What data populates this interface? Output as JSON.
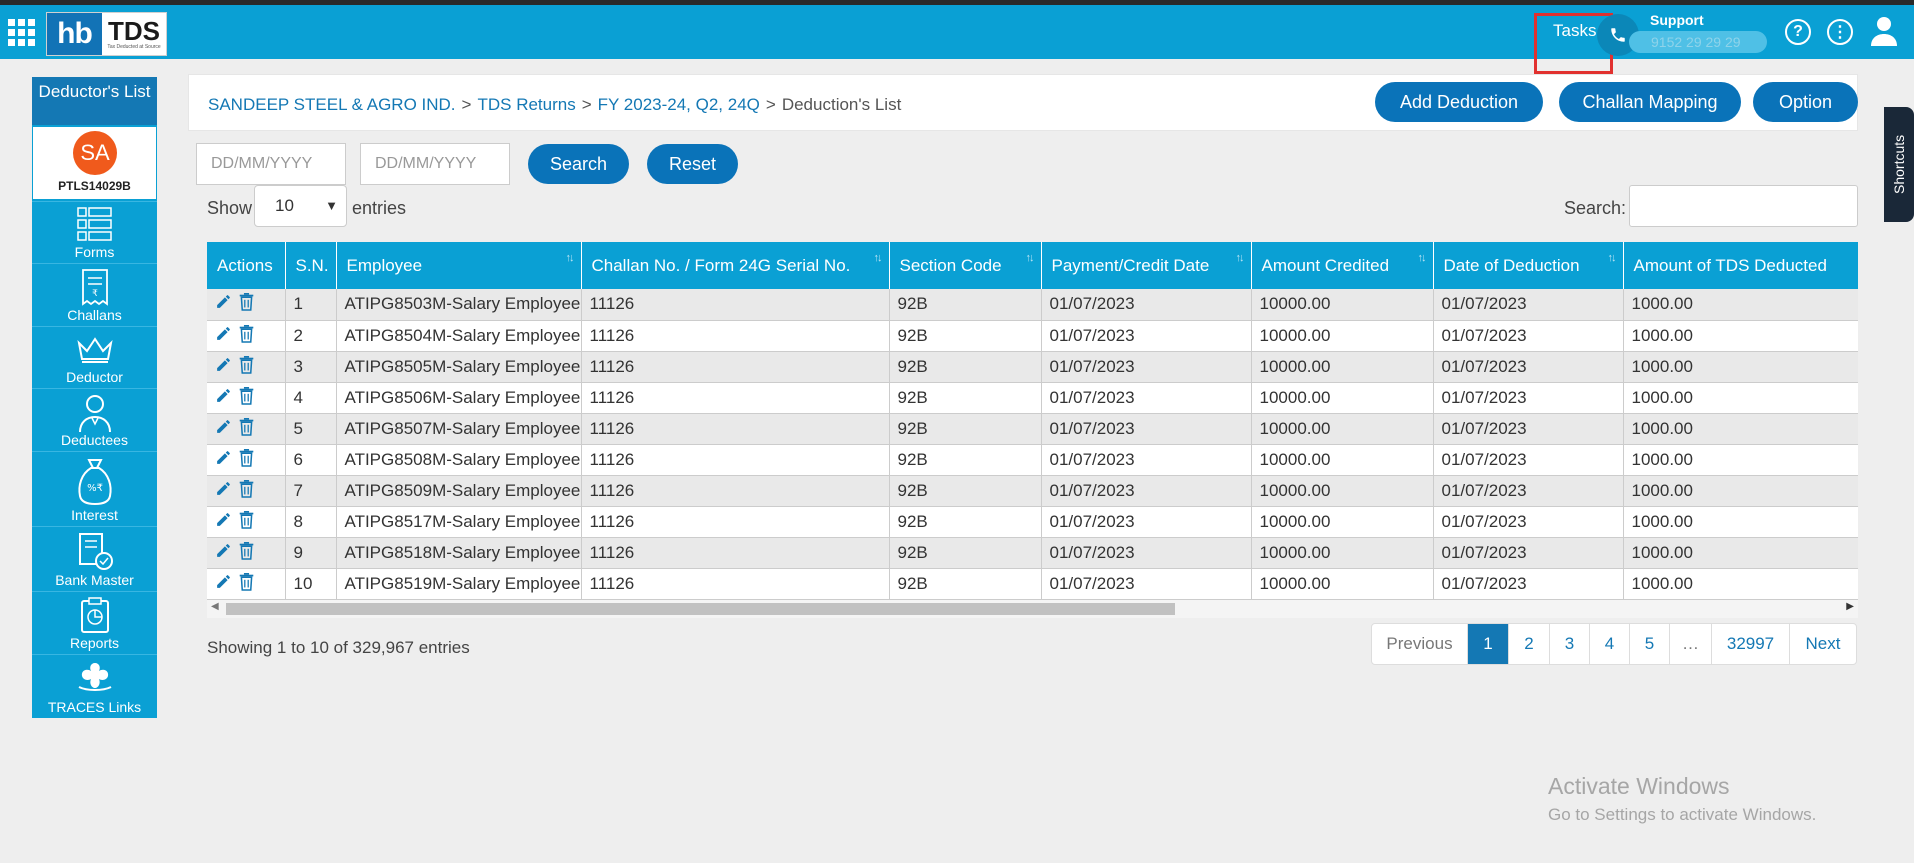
{
  "header": {
    "logo_hb": "hb",
    "logo_tds": "TDS",
    "logo_tagline": "Tax Deducted at Source",
    "tasks_label": "Tasks",
    "support_label": "Support",
    "support_number": "9152 29 29 29"
  },
  "sidebar": {
    "title": "Deductor's List",
    "user_initials": "SA",
    "user_pan": "PTLS14029B",
    "items": [
      {
        "label": "Forms",
        "icon": "forms-icon"
      },
      {
        "label": "Challans",
        "icon": "challans-icon"
      },
      {
        "label": "Deductor",
        "icon": "crown-icon"
      },
      {
        "label": "Deductees",
        "icon": "deductees-icon"
      },
      {
        "label": "Interest",
        "icon": "money-bag-icon"
      },
      {
        "label": "Bank Master",
        "icon": "bank-icon"
      },
      {
        "label": "Reports",
        "icon": "clipboard-icon"
      },
      {
        "label": "TRACES Links",
        "icon": "traces-icon"
      }
    ]
  },
  "shortcuts_label": "Shortcuts",
  "breadcrumb": {
    "company": "SANDEEP STEEL & AGRO IND.",
    "section": "TDS Returns",
    "period": "FY 2023-24, Q2, 24Q",
    "current": "Deduction's List"
  },
  "actions": {
    "add_deduction": "Add Deduction",
    "challan_mapping": "Challan Mapping",
    "option": "Option"
  },
  "filters": {
    "from_placeholder": "DD/MM/YYYY",
    "to_placeholder": "DD/MM/YYYY",
    "search_button": "Search",
    "reset_button": "Reset"
  },
  "table_controls": {
    "show_label": "Show",
    "page_size": "10",
    "entries_label": "entries",
    "search_label": "Search:"
  },
  "table": {
    "columns": [
      "Actions",
      "S.N.",
      "Employee",
      "Challan No. / Form 24G Serial No.",
      "Section Code",
      "Payment/Credit Date",
      "Amount Credited",
      "Date of Deduction",
      "Amount of TDS Deducted"
    ],
    "rows": [
      {
        "sn": "1",
        "employee": "ATIPG8503M-Salary Employee",
        "challan": "11126",
        "section": "92B",
        "payment_date": "01/07/2023",
        "amount": "10000.00",
        "deduction_date": "01/07/2023",
        "tds": "1000.00"
      },
      {
        "sn": "2",
        "employee": "ATIPG8504M-Salary Employee",
        "challan": "11126",
        "section": "92B",
        "payment_date": "01/07/2023",
        "amount": "10000.00",
        "deduction_date": "01/07/2023",
        "tds": "1000.00"
      },
      {
        "sn": "3",
        "employee": "ATIPG8505M-Salary Employee",
        "challan": "11126",
        "section": "92B",
        "payment_date": "01/07/2023",
        "amount": "10000.00",
        "deduction_date": "01/07/2023",
        "tds": "1000.00"
      },
      {
        "sn": "4",
        "employee": "ATIPG8506M-Salary Employee",
        "challan": "11126",
        "section": "92B",
        "payment_date": "01/07/2023",
        "amount": "10000.00",
        "deduction_date": "01/07/2023",
        "tds": "1000.00"
      },
      {
        "sn": "5",
        "employee": "ATIPG8507M-Salary Employee",
        "challan": "11126",
        "section": "92B",
        "payment_date": "01/07/2023",
        "amount": "10000.00",
        "deduction_date": "01/07/2023",
        "tds": "1000.00"
      },
      {
        "sn": "6",
        "employee": "ATIPG8508M-Salary Employee",
        "challan": "11126",
        "section": "92B",
        "payment_date": "01/07/2023",
        "amount": "10000.00",
        "deduction_date": "01/07/2023",
        "tds": "1000.00"
      },
      {
        "sn": "7",
        "employee": "ATIPG8509M-Salary Employee",
        "challan": "11126",
        "section": "92B",
        "payment_date": "01/07/2023",
        "amount": "10000.00",
        "deduction_date": "01/07/2023",
        "tds": "1000.00"
      },
      {
        "sn": "8",
        "employee": "ATIPG8517M-Salary Employee",
        "challan": "11126",
        "section": "92B",
        "payment_date": "01/07/2023",
        "amount": "10000.00",
        "deduction_date": "01/07/2023",
        "tds": "1000.00"
      },
      {
        "sn": "9",
        "employee": "ATIPG8518M-Salary Employee",
        "challan": "11126",
        "section": "92B",
        "payment_date": "01/07/2023",
        "amount": "10000.00",
        "deduction_date": "01/07/2023",
        "tds": "1000.00"
      },
      {
        "sn": "10",
        "employee": "ATIPG8519M-Salary Employee",
        "challan": "11126",
        "section": "92B",
        "payment_date": "01/07/2023",
        "amount": "10000.00",
        "deduction_date": "01/07/2023",
        "tds": "1000.00"
      }
    ]
  },
  "footer": {
    "info": "Showing 1 to 10 of 329,967 entries",
    "pagination": [
      "Previous",
      "1",
      "2",
      "3",
      "4",
      "5",
      "…",
      "32997",
      "Next"
    ],
    "active_page": "1"
  },
  "watermark": {
    "line1": "Activate Windows",
    "line2": "Go to Settings to activate Windows."
  },
  "colors": {
    "primary": "#0aa0d4",
    "button": "#0a73b9",
    "highlight_box": "#e1312f",
    "avatar": "#f05a1c"
  }
}
